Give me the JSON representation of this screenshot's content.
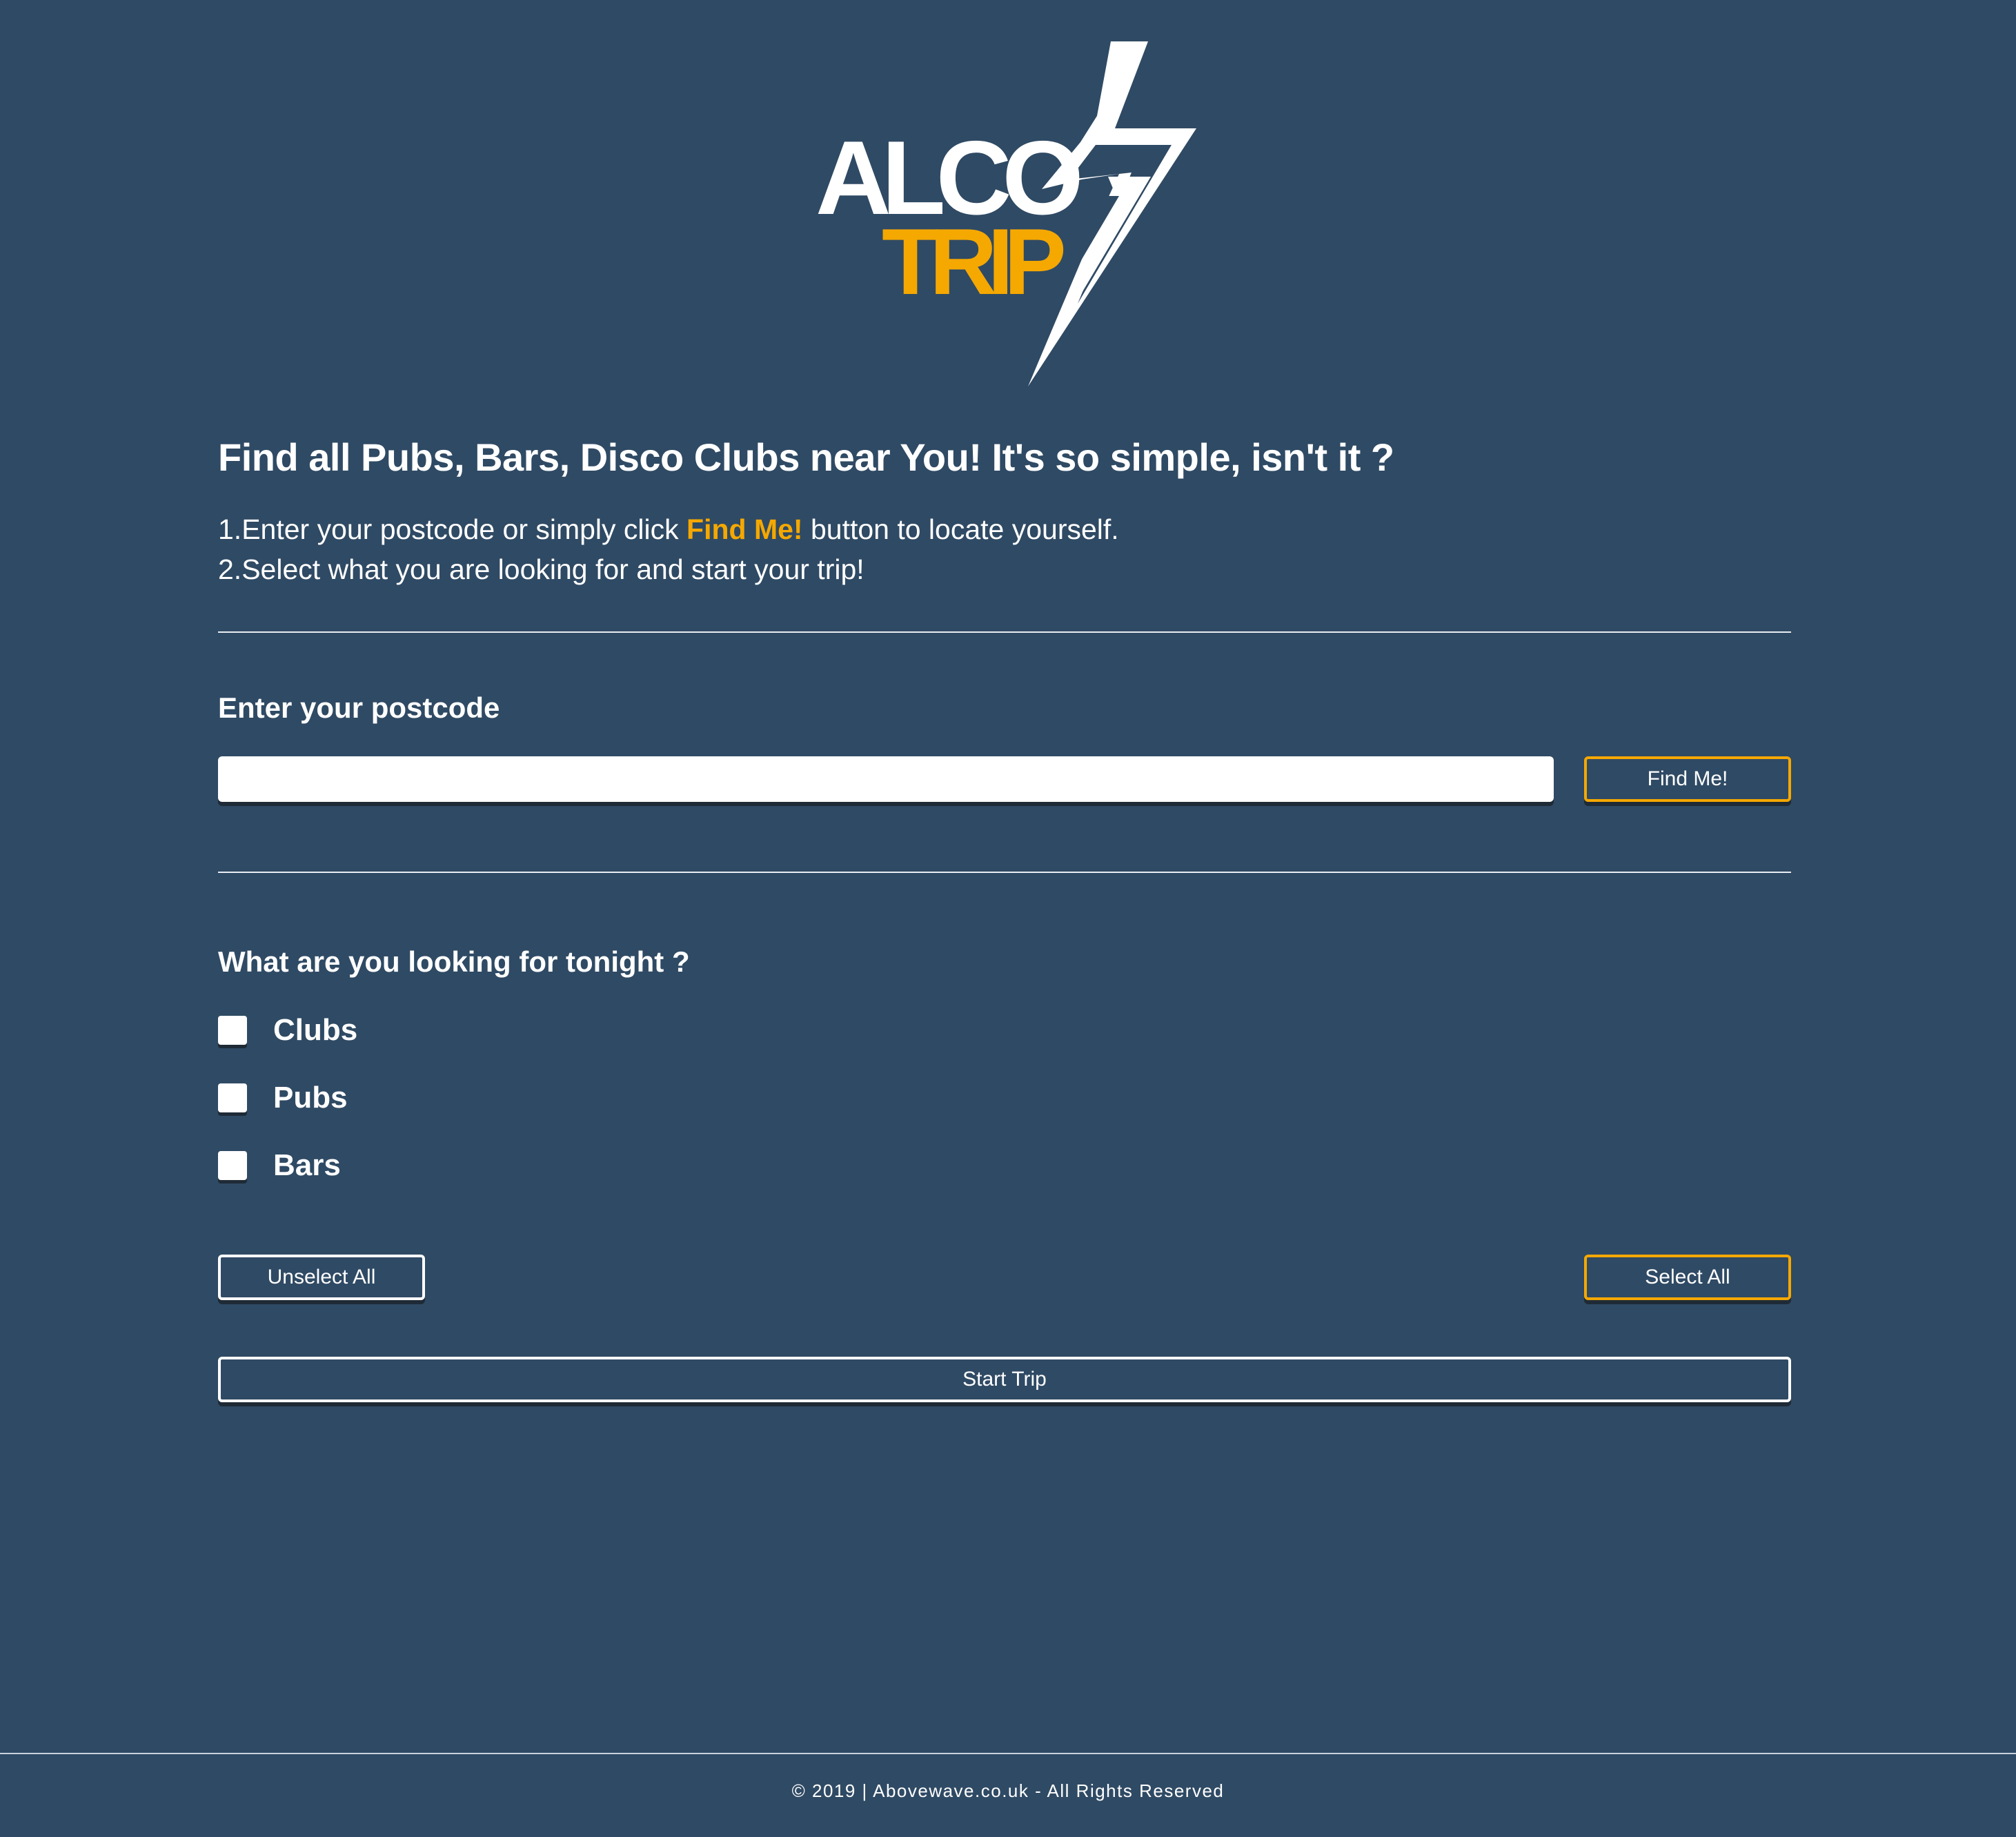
{
  "logo": {
    "line1": "ALCO",
    "line2": "TRIP",
    "colors": {
      "primary": "#ffffff",
      "accent": "#f5a800"
    }
  },
  "intro": {
    "headline": "Find all Pubs, Bars, Disco Clubs near You! It's so simple, isn't it ?",
    "step1_before": "1.Enter your postcode or simply click ",
    "step1_highlight": "Find Me!",
    "step1_after": " button to locate yourself.",
    "step2": "2.Select what you are looking for and start your trip!"
  },
  "postcode": {
    "label": "Enter your postcode",
    "value": "",
    "placeholder": "",
    "find_button": "Find Me!"
  },
  "venues": {
    "label": "What are you looking for tonight ?",
    "options": [
      {
        "label": "Clubs",
        "checked": false
      },
      {
        "label": "Pubs",
        "checked": false
      },
      {
        "label": "Bars",
        "checked": false
      }
    ],
    "unselect_all": "Unselect All",
    "select_all": "Select All",
    "start_trip": "Start Trip"
  },
  "footer": {
    "text": "© 2019 | Abovewave.co.uk - All Rights Reserved"
  },
  "colors": {
    "background": "#2f4a64",
    "accent": "#f5a800",
    "text": "#ffffff"
  }
}
